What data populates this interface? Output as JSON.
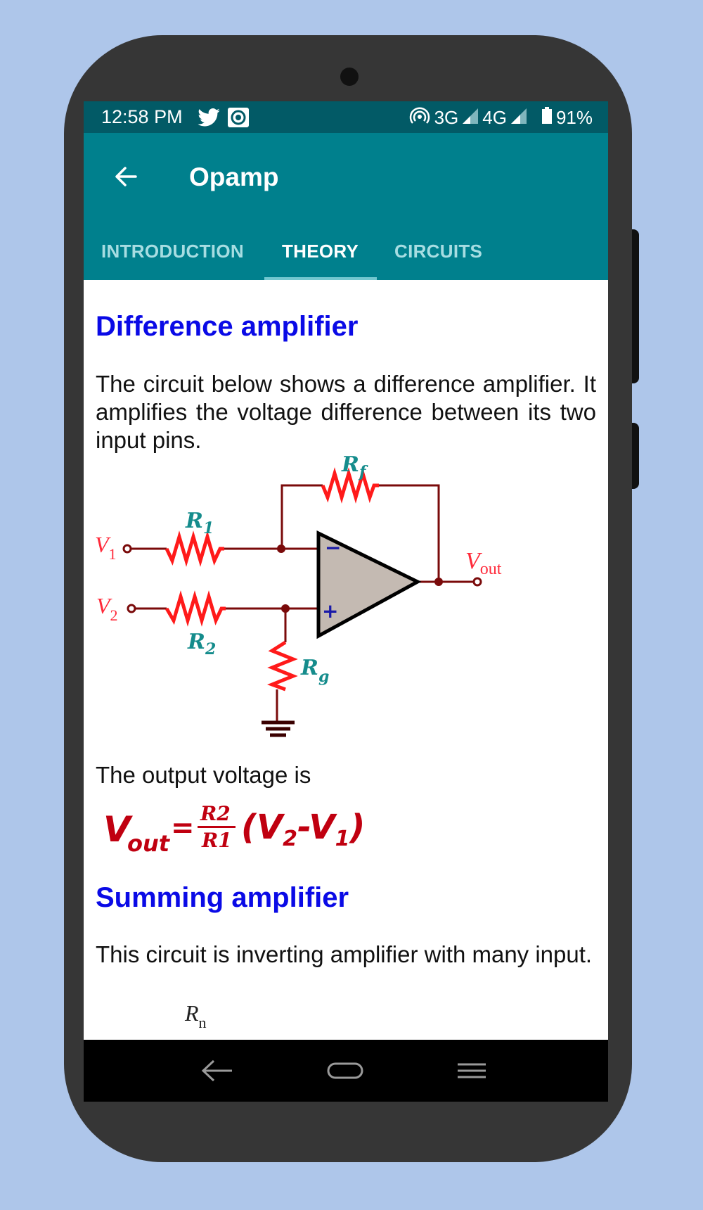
{
  "status_bar": {
    "time": "12:58 PM",
    "left_icons": [
      "twitter-icon",
      "camera-record-icon"
    ],
    "right_icons": [
      "hotspot-icon",
      "signal-3g-icon",
      "signal-4g-icon",
      "battery-icon"
    ],
    "network_1": "3G",
    "network_2": "4G",
    "battery": "91%"
  },
  "app_bar": {
    "back_icon": "arrow-left-icon",
    "title": "Opamp"
  },
  "tabs": {
    "items": [
      {
        "label": "INTRODUCTION",
        "active": false
      },
      {
        "label": "THEORY",
        "active": true
      },
      {
        "label": "CIRCUITS",
        "active": false
      }
    ]
  },
  "content": {
    "section1": {
      "heading": "Difference amplifier",
      "paragraph": "The circuit below shows a difference amplifier. It amplifies the voltage difference between its two input pins.",
      "diagram": {
        "labels": {
          "rf": "R",
          "rf_sub": "f",
          "r1": "R",
          "r1_sub": "1",
          "r2": "R",
          "r2_sub": "2",
          "rg": "R",
          "rg_sub": "g",
          "v1": "V",
          "v1_sub": "1",
          "v2": "V",
          "v2_sub": "2",
          "vout": "V",
          "vout_sub": "out",
          "minus": "−",
          "plus": "+"
        }
      },
      "output_text": "The output voltage is",
      "formula": {
        "lhs": "V",
        "lhs_sub": "out",
        "equals": "=",
        "numerator": "R2",
        "denominator": "R1",
        "open": "(",
        "v2": "V",
        "v2_sub": "2",
        "minus": "-",
        "v1": "V",
        "v1_sub": "1",
        "close": ")"
      }
    },
    "section2": {
      "heading": "Summing amplifier",
      "paragraph": "This circuit is inverting amplifier with many input.",
      "partial_label": "R",
      "partial_label_sub": "n"
    }
  },
  "nav_bar": {
    "back": "nav-back-icon",
    "home": "nav-home-icon",
    "menu": "nav-recents-icon"
  },
  "colors": {
    "status_bar": "#025a66",
    "app_bar": "#00808d",
    "heading": "#0a0ae6",
    "formula": "#c00010",
    "resistor": "#ff1a1a",
    "wire": "#7a0a0a",
    "label_teal": "#158c8c"
  }
}
